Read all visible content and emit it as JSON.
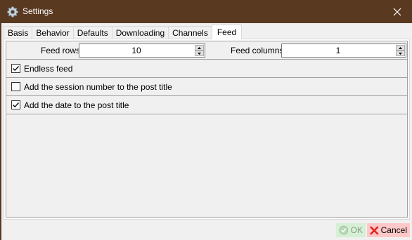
{
  "window": {
    "title": "Settings"
  },
  "tabs": [
    {
      "label": "Basis",
      "active": false
    },
    {
      "label": "Behavior",
      "active": false
    },
    {
      "label": "Defaults",
      "active": false
    },
    {
      "label": "Downloading",
      "active": false
    },
    {
      "label": "Channels",
      "active": false
    },
    {
      "label": "Feed",
      "active": true
    }
  ],
  "feed": {
    "rows_label": "Feed rows",
    "rows_value": "10",
    "columns_label": "Feed columns",
    "columns_value": "1",
    "options": [
      {
        "label": "Endless feed",
        "checked": true
      },
      {
        "label": "Add the session number to the post title",
        "checked": false
      },
      {
        "label": "Add the date to the post title",
        "checked": true
      }
    ]
  },
  "footer": {
    "ok_label": "OK",
    "cancel_label": "Cancel"
  },
  "colors": {
    "titlebar": "#5a3921",
    "ok_bg": "#d6f0d6",
    "cancel_bg": "#ffc8c8"
  }
}
